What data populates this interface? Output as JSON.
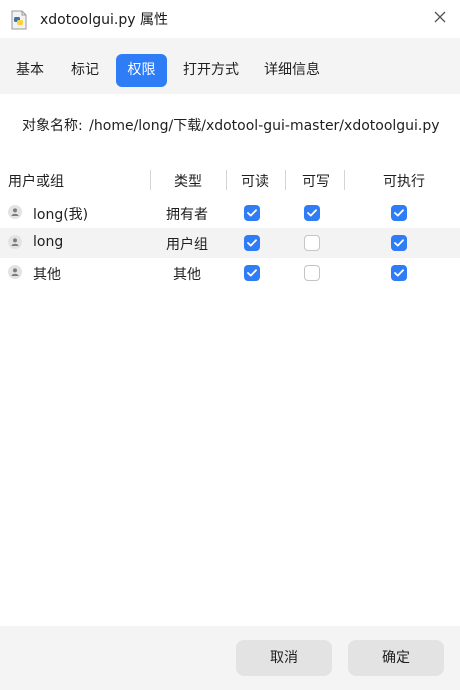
{
  "window": {
    "title": "xdotoolgui.py 属性",
    "app_icon": "python-file-icon",
    "close_icon": "close-icon"
  },
  "tabs": [
    {
      "label": "基本",
      "active": false
    },
    {
      "label": "标记",
      "active": false
    },
    {
      "label": "权限",
      "active": true
    },
    {
      "label": "打开方式",
      "active": false
    },
    {
      "label": "详细信息",
      "active": false
    }
  ],
  "object": {
    "label": "对象名称:",
    "path": "/home/long/下载/xdotool-gui-master/xdotoolgui.py"
  },
  "table": {
    "headers": {
      "user": "用户或组",
      "type": "类型",
      "read": "可读",
      "write": "可写",
      "exec": "可执行"
    },
    "rows": [
      {
        "name": "long(我)",
        "type": "拥有者",
        "read": true,
        "write": true,
        "exec": true
      },
      {
        "name": "long",
        "type": "用户组",
        "read": true,
        "write": false,
        "exec": true
      },
      {
        "name": "其他",
        "type": "其他",
        "read": true,
        "write": false,
        "exec": true
      }
    ]
  },
  "buttons": {
    "cancel": "取消",
    "ok": "确定"
  },
  "colors": {
    "accent": "#2f7df6",
    "tab_bar": "#f4f4f4",
    "alt_row": "#f3f3f3"
  }
}
